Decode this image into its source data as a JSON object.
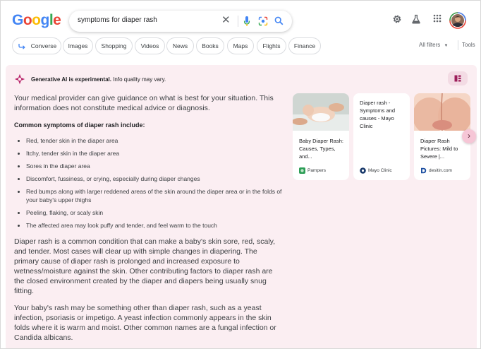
{
  "header": {
    "logo": [
      "G",
      "o",
      "o",
      "g",
      "l",
      "e"
    ],
    "logo_colors": [
      "#4285F4",
      "#EA4335",
      "#FBBC05",
      "#4285F4",
      "#34A853",
      "#EA4335"
    ],
    "search_value": "symptoms for diaper rash"
  },
  "chips": [
    "Converse",
    "Images",
    "Shopping",
    "Videos",
    "News",
    "Books",
    "Maps",
    "Flights",
    "Finance"
  ],
  "filters": {
    "all_filters": "All filters",
    "tools": "Tools"
  },
  "ai": {
    "heading_bold": "Generative AI is experimental.",
    "heading_rest": " Info quality may vary.",
    "intro": "Your medical provider can give guidance on what is best for your situation. This information does not constitute medical advice or diagnosis.",
    "list_title": "Common symptoms of diaper rash include:",
    "symptoms": [
      "Red, tender skin in the diaper area",
      "Itchy, tender skin in the diaper area",
      "Sores in the diaper area",
      "Discomfort, fussiness, or crying, especially during diaper changes",
      "Red bumps along with larger reddened areas of the skin around the diaper area or in the folds of your baby's upper thighs",
      "Peeling, flaking, or scaly skin",
      "The affected area may look puffy and tender, and feel warm to the touch"
    ],
    "para1": "Diaper rash is a common condition that can make a baby's skin sore, red, scaly, and tender. Most cases will clear up with simple changes in diapering. The primary cause of diaper rash is prolonged and increased exposure to wetness/moisture against the skin. Other contributing factors to diaper rash are the closed environment created by the diaper and diapers being usually snug fitting.",
    "para2": "Your baby's rash may be something other than diaper rash, such as a yeast infection, psoriasis or impetigo. A yeast infection commonly appears in the skin folds where it is warm and moist. Other common names are a fungal infection or Candida albicans."
  },
  "cards": [
    {
      "title": "Baby Diaper Rash: Causes, Types, and...",
      "source": "Pampers"
    },
    {
      "title": "Diaper rash - Symptoms and causes - Mayo Clinic",
      "source": "Mayo Clinic"
    },
    {
      "title": "Diaper Rash Pictures: Mild to Severe |...",
      "source": "desitin.com"
    }
  ]
}
